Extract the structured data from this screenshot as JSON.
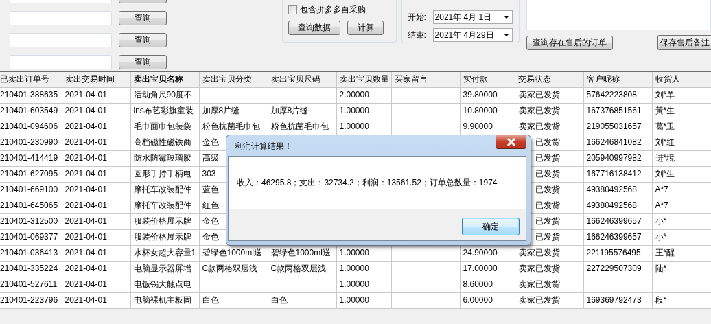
{
  "search_rows": [
    {
      "value": ""
    },
    {
      "value": "",
      "button": "查询"
    },
    {
      "value": "",
      "button": "查询"
    },
    {
      "value": "",
      "button": "查询"
    }
  ],
  "options": {
    "checkbox": {
      "label": "包含拼多多自采购",
      "checked": false
    },
    "buttons": [
      "查询数据",
      "计算"
    ]
  },
  "date_range": [
    {
      "label": "开始:",
      "value": "2021年 4月 1日"
    },
    {
      "label": "结束:",
      "value": "2021年 4月29日"
    }
  ],
  "after_sale": {
    "buttons": [
      "查询存在售后的订单",
      "保存售后备注"
    ]
  },
  "table": {
    "columns": [
      {
        "label": "已卖出订单号",
        "sorted": false
      },
      {
        "label": "卖出交易时间",
        "sorted": false
      },
      {
        "label": "卖出宝贝名称",
        "sorted": true
      },
      {
        "label": "卖出宝贝分类",
        "sorted": false
      },
      {
        "label": "卖出宝贝尺码",
        "sorted": false
      },
      {
        "label": "卖出宝贝数量",
        "sorted": false
      },
      {
        "label": "买家留言",
        "sorted": false
      },
      {
        "label": "实付款",
        "sorted": false
      },
      {
        "label": "交易状态",
        "sorted": false
      },
      {
        "label": "客户昵称",
        "sorted": false
      },
      {
        "label": "收货人",
        "sorted": false
      }
    ],
    "rows": [
      [
        "210401-388635",
        "2021-04-01",
        "活动角尺90度不",
        "",
        "",
        "2.00000",
        "",
        "39.80000",
        "卖家已发货",
        "57642223808",
        "刘*单"
      ],
      [
        "210401-603549",
        "2021-04-01",
        "ins布艺彩旗童装",
        "加厚8片缝",
        "加厚8片缝",
        "1.00000",
        "",
        "10.80000",
        "卖家已发货",
        "167376851561",
        "黃*生"
      ],
      [
        "210401-094606",
        "2021-04-01",
        "毛巾面巾包装袋",
        "粉色抗菌毛巾包",
        "粉色抗菌毛巾包",
        "1.00000",
        "",
        "9.90000",
        "卖家已发货",
        "219055031657",
        "葛*卫"
      ],
      [
        "210401-230990",
        "2021-04-01",
        "高档磁性磁铁商",
        "金色",
        "",
        "",
        "",
        "",
        "已发货",
        "166246841082",
        "刘*红"
      ],
      [
        "210401-414419",
        "2021-04-01",
        "防水防霉玻璃胶",
        "高级",
        "",
        "",
        "",
        "",
        "已发货",
        "205940997982",
        "进*境"
      ],
      [
        "210401-627095",
        "2021-04-01",
        "圆形手持手柄电",
        "303",
        "",
        "",
        "",
        "",
        "已发货",
        "167716138412",
        "刘*生"
      ],
      [
        "210401-669100",
        "2021-04-01",
        "摩托车改装配件",
        "蓝色",
        "",
        "",
        "",
        "",
        "已发货",
        "49380492568",
        "A*7"
      ],
      [
        "210401-645065",
        "2021-04-01",
        "摩托车改装配件",
        "红色",
        "",
        "",
        "",
        "",
        "已发货",
        "49380492568",
        "A*7"
      ],
      [
        "210401-312500",
        "2021-04-01",
        "服装价格展示牌",
        "金色",
        "",
        "",
        "",
        "",
        "已发货",
        "166246399657",
        "小*"
      ],
      [
        "210401-069377",
        "2021-04-01",
        "服装价格展示牌",
        "金色",
        "",
        "",
        "",
        "",
        "已发货",
        "166246399657",
        "小*"
      ],
      [
        "210401-036413",
        "2021-04-01",
        "水杯女超大容量1",
        "碧绿色1000ml送",
        "碧绿色1000ml送",
        "1.00000",
        "",
        "24.90000",
        "卖家已发货",
        "221195576495",
        "王*醒"
      ],
      [
        "210401-335224",
        "2021-04-01",
        "电脑显示器屏增",
        "C款两格双层浅",
        "C款两格双层浅",
        "1.00000",
        "",
        "17.00000",
        "卖家已发货",
        "227229507309",
        "陆*"
      ],
      [
        "210401-527611",
        "2021-04-01",
        "电饭锅大触点电",
        "",
        "",
        "1.00000",
        "",
        "8.60000",
        "卖家已发货",
        "",
        ""
      ],
      [
        "210401-223796",
        "2021-04-01",
        "电脑裸机主板固",
        "白色",
        "白色",
        "1.00000",
        "",
        "6.00000",
        "卖家已发货",
        "169369792473",
        "段*"
      ]
    ]
  },
  "dialog": {
    "title": "利润计算结果！",
    "message": "收入：46295.8；支出：32734.2；利润：13561.52；订单总数量：1974",
    "button": "确定"
  }
}
